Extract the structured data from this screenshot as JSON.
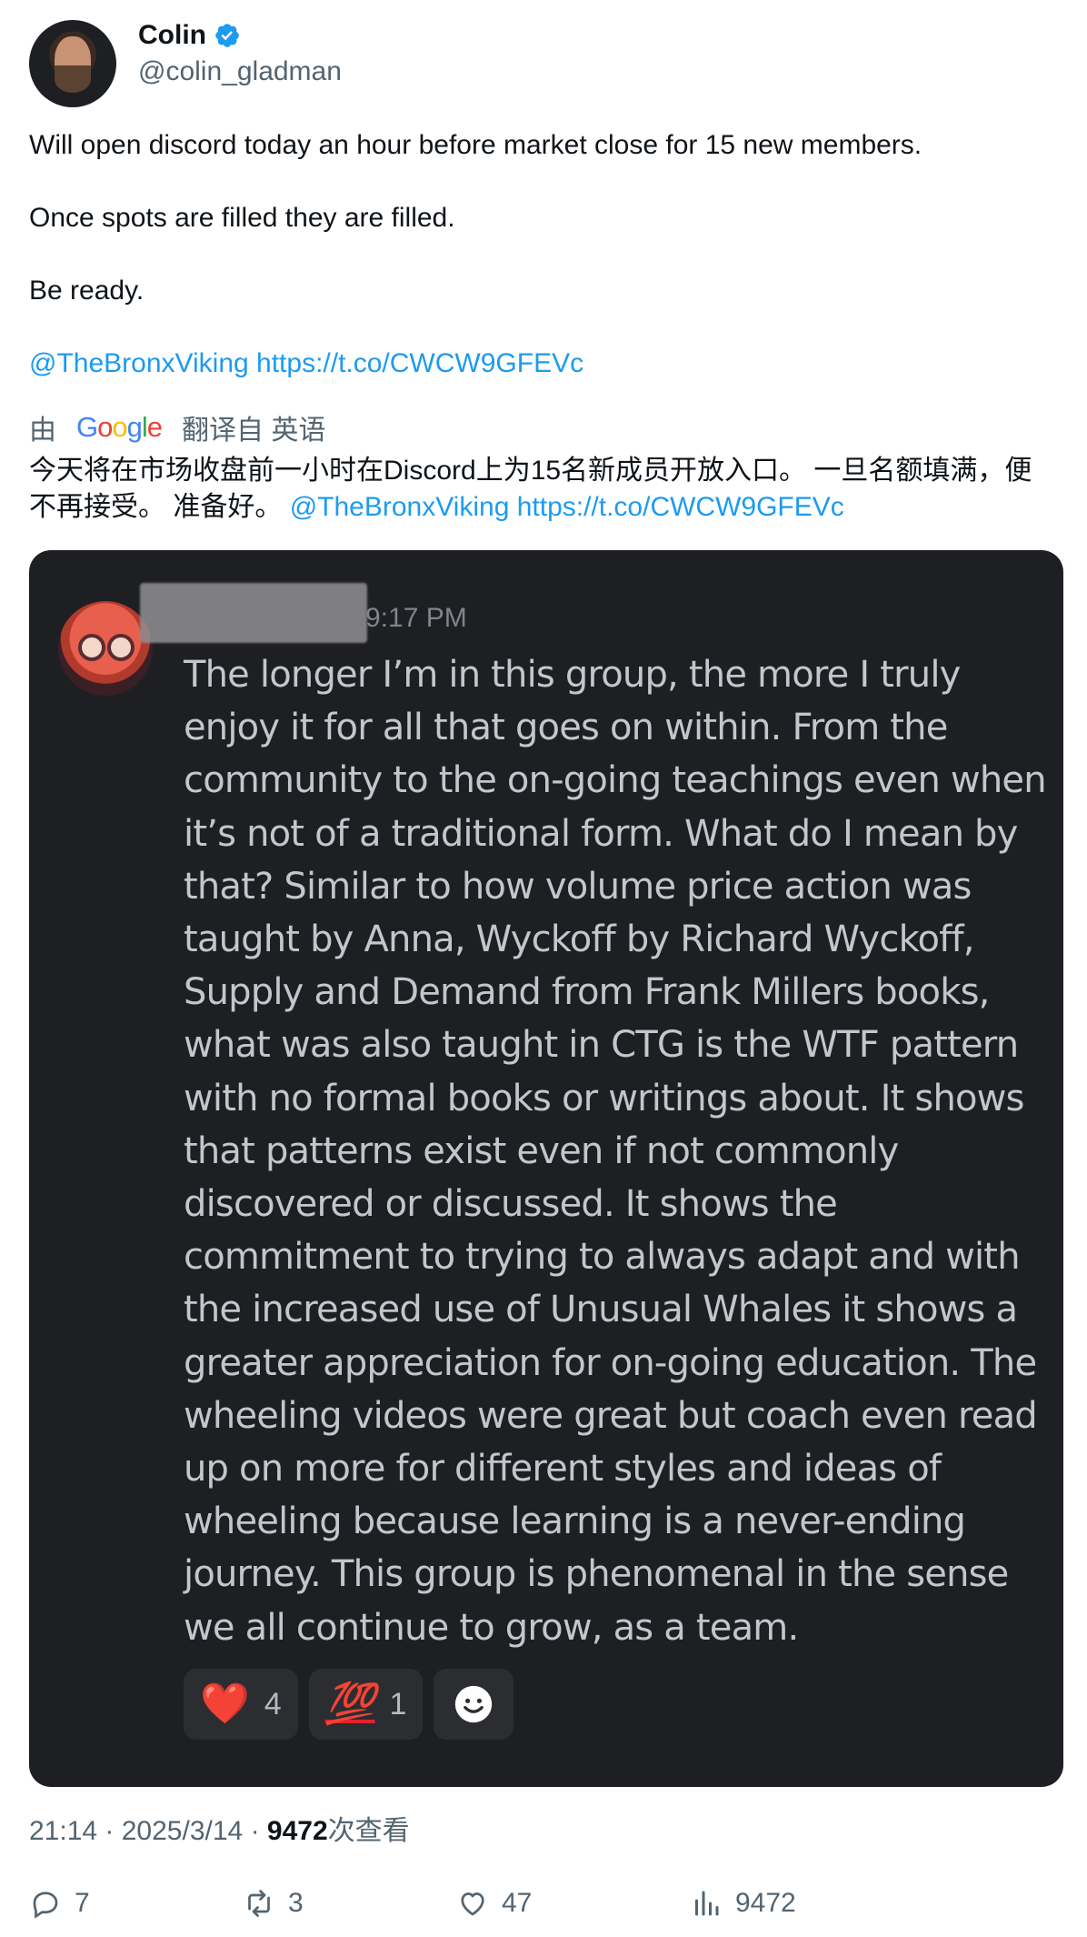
{
  "author": {
    "name": "Colin",
    "handle": "@colin_gladman"
  },
  "tweet": {
    "line1": "Will open discord today an hour before market close for 15 new members.",
    "line2": "Once spots are filled they are filled.",
    "line3": "Be ready.",
    "mention": "@TheBronxViking",
    "url": "https://t.co/CWCW9GFEVc"
  },
  "translation": {
    "prefix": "由",
    "provider": "Google",
    "suffix": "翻译自 英语",
    "text": "今天将在市场收盘前一小时在Discord上为15名新成员开放入口。 一旦名额填满，便不再接受。 准备好。",
    "mention": "@TheBronxViking",
    "url": "https://t.co/CWCW9GFEVc"
  },
  "discord": {
    "time": "9:17 PM",
    "message": "The longer I’m in this group, the more I truly enjoy it for all that goes on within. From the community to the on-going teachings even when it’s not of a traditional form. What do I mean by that? Similar to how volume price action was taught by Anna, Wyckoff by Richard Wyckoff, Supply and Demand from Frank Millers books, what was also taught in CTG is the WTF pattern with no formal books or writings about. It shows that patterns exist even if not commonly discovered or discussed. It shows the commitment to trying to always adapt and with the increased use of Unusual Whales it shows a greater appreciation for on-going education. The wheeling videos were great but coach even read up on more for different styles and ideas of wheeling because learning is a never-ending journey. This group is phenomenal in the sense we all continue to grow, as a team.",
    "reactions": [
      {
        "emoji": "❤️",
        "count": "4"
      },
      {
        "emoji": "💯",
        "count": "1"
      }
    ]
  },
  "meta": {
    "time": "21:14",
    "date": "2025/3/14",
    "views": "9472",
    "views_label": "次查看"
  },
  "actions": {
    "replies": "7",
    "reposts": "3",
    "likes": "47",
    "views": "9472"
  },
  "colors": {
    "link": "#1d9bf0",
    "verified": "#1d9bf0",
    "discord_bg": "#1e1f22",
    "muted": "#536471"
  }
}
